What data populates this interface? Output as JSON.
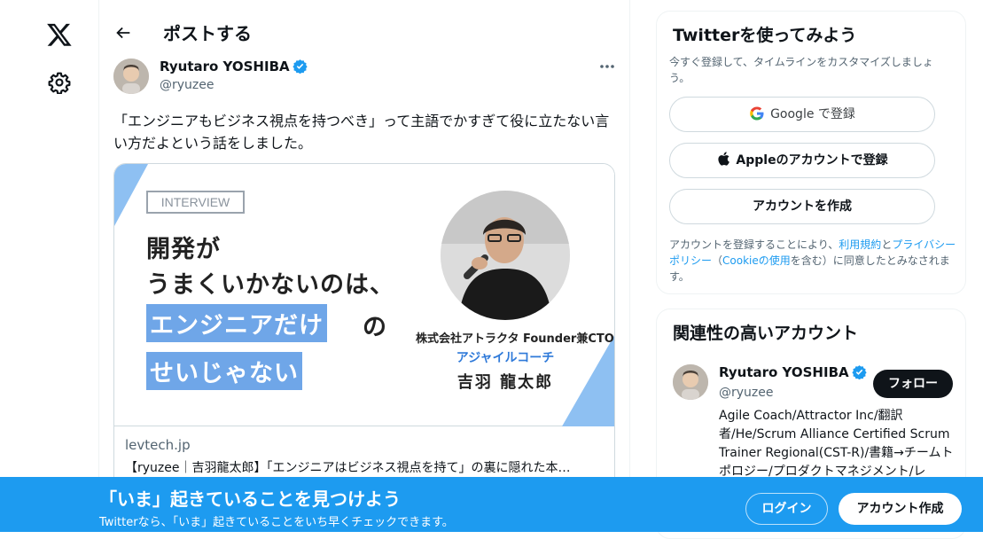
{
  "header": {
    "title": "ポストする"
  },
  "post": {
    "author_name": "Ryutaro YOSHIBA",
    "author_handle": "@ryuzee",
    "text": "「エンジニアもビジネス視点を持つべき」って主語でかすぎて役に立たない言い方だよという話をしました。",
    "card": {
      "badge": "INTERVIEW",
      "headline_1": "開発が",
      "headline_2": "うまくいかないのは、",
      "headline_3": "エンジニアだけ",
      "headline_3_suffix": "の",
      "headline_4": "せいじゃない",
      "company": "株式会社アトラクタ Founder兼CTO",
      "role": "アジャイルコーチ",
      "person": "吉羽 龍太郎",
      "domain": "levtech.jp",
      "title": "【ryuzee｜吉羽龍太郎】「エンジニアはビジネス視点を持て」の裏に隠れた本…"
    }
  },
  "signup": {
    "title": "Twitterを使ってみよう",
    "subtitle": "今すぐ登録して、タイムラインをカスタマイズしましょう。",
    "google_label": "Google で登録",
    "apple_label": "Appleのアカウントで登録",
    "create_label": "アカウントを作成",
    "terms_prefix": "アカウントを登録することにより、",
    "terms_link": "利用規約",
    "terms_and": "と",
    "privacy_link": "プライバシーポリシー",
    "terms_mid": "（",
    "cookie_link": "Cookieの使用",
    "terms_suffix": "を含む）に同意したとみなされます。"
  },
  "related": {
    "title": "関連性の高いアカウント",
    "name": "Ryutaro YOSHIBA",
    "handle": "@ryuzee",
    "follow_label": "フォロー",
    "bio": "Agile Coach/Attractor Inc/翻訳者/He/Scrum Alliance Certified Scrum Trainer Regional(CST-R)/書籍→チームトポロジー/プロダクトマネジメント/レ"
  },
  "banner": {
    "title": "「いま」起きていることを見つけよう",
    "subtitle": "Twitterなら、「いま」起きていることをいち早くチェックできます。",
    "login_label": "ログイン",
    "signup_label": "アカウント作成"
  },
  "colors": {
    "accent": "#1d9bf0",
    "card_highlight": "#6fa6e8",
    "role_text": "#2f7ad9"
  },
  "icons": [
    "x-logo-icon",
    "gear-icon",
    "back-arrow-icon",
    "verified-badge-icon",
    "more-icon",
    "google-icon",
    "apple-icon"
  ]
}
